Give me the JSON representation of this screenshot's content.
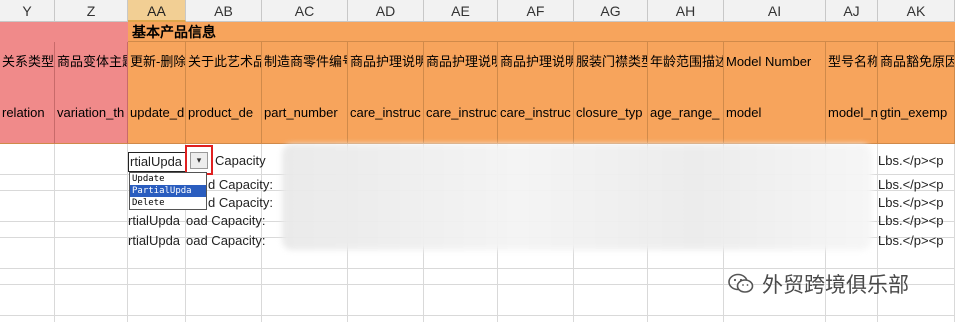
{
  "columns": [
    "Y",
    "Z",
    "AA",
    "AB",
    "AC",
    "AD",
    "AE",
    "AF",
    "AG",
    "AH",
    "AI",
    "AJ",
    "AK"
  ],
  "section_title": "基本产品信息",
  "labels_cn": [
    "关系类型",
    "商品变体主题",
    "更新-删除",
    "关于此艺术品",
    "制造商零件编号",
    "商品护理说明",
    "商品护理说明",
    "商品护理说明",
    "服装门襟类型",
    "年龄范围描述",
    "Model Number",
    "型号名称",
    "商品豁免原因"
  ],
  "field_names": [
    "relation",
    "variation_th",
    "update_d",
    "product_de",
    "part_number",
    "care_instruc",
    "care_instruc",
    "care_instruc",
    "closure_typ",
    "age_range_",
    "model",
    "model_n",
    "gtin_exemp"
  ],
  "row1": {
    "aa": "rtialUpda",
    "ab": "Capacity",
    "ak": "Lbs.</p><p"
  },
  "row2": {
    "aa": "Update",
    "ab": "d Capacity:",
    "ak": "Lbs.</p><p"
  },
  "row3": {
    "aa": "Update",
    "ab": "d Capacity:",
    "ak": "Lbs.</p><p"
  },
  "row4": {
    "aa": "rtialUpda",
    "ab": "oad Capacity:",
    "ak": "Lbs.</p><p"
  },
  "row5": {
    "aa": "rtialUpda",
    "ab": "oad Capacity:",
    "ak": "Lbs.</p><p"
  },
  "dropdown": {
    "options": [
      "Update",
      "PartialUpda",
      "Delete"
    ],
    "selected_index": 1,
    "arrow": "▾"
  },
  "watermark": {
    "text": "外贸跨境俱乐部",
    "icon": "wechat-icon"
  },
  "colors": {
    "header_orange": "#f7a45c",
    "pink": "#f08a8a",
    "selected_header": "#f2cf94",
    "dropdown_highlight": "#2a5dbf",
    "callout": "#e02020"
  }
}
